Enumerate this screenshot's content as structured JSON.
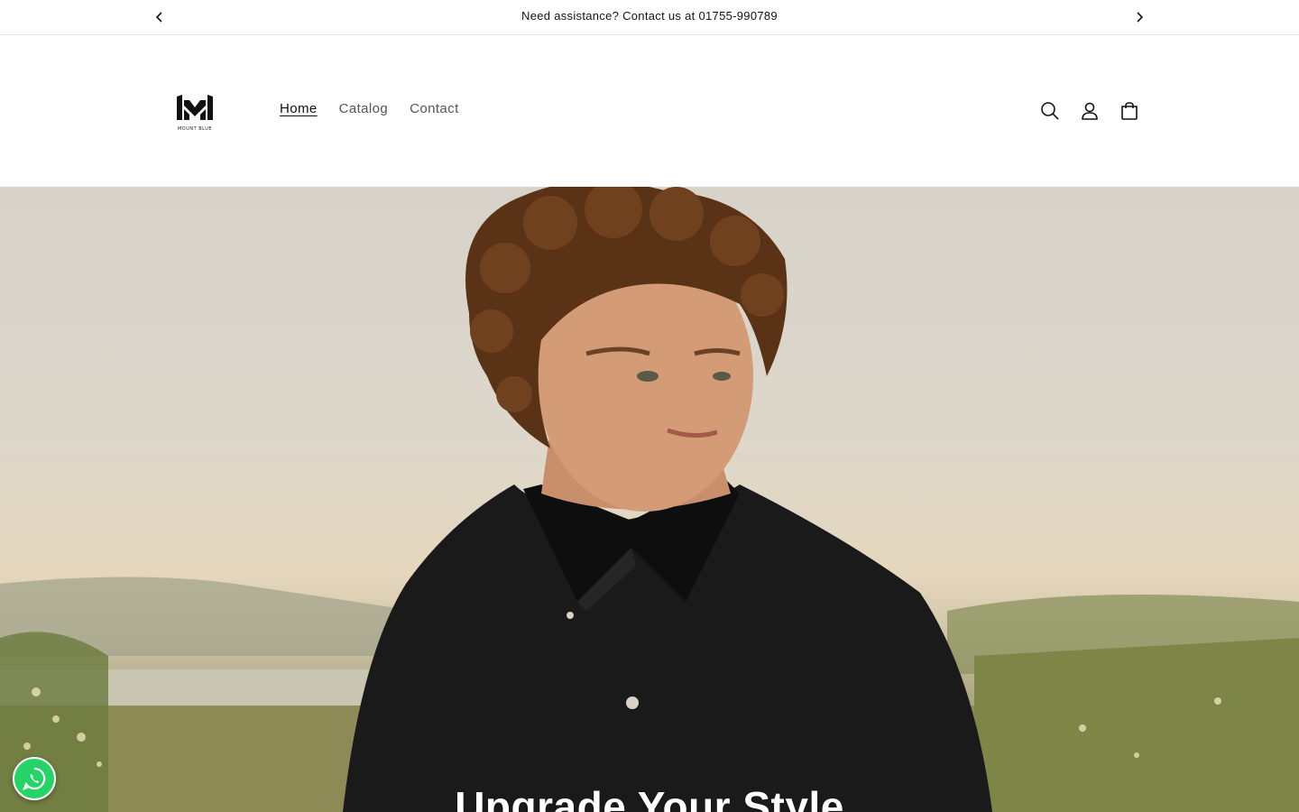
{
  "announcement": {
    "text": "Need assistance? Contact us at 01755-990789",
    "prev_icon": "chevron-left-icon",
    "next_icon": "chevron-right-icon"
  },
  "header": {
    "logo_text": "MOUNT BLUE",
    "nav": [
      {
        "label": "Home",
        "active": true
      },
      {
        "label": "Catalog",
        "active": false
      },
      {
        "label": "Contact",
        "active": false
      }
    ],
    "icons": [
      "search-icon",
      "account-icon",
      "cart-icon"
    ]
  },
  "hero": {
    "title": "Upgrade Your Style",
    "image_alt": "Man with curly hair wearing black shirt in a field"
  },
  "floating": {
    "whatsapp_icon": "whatsapp-icon"
  },
  "colors": {
    "text": "#121212",
    "border": "#e6e6e6",
    "whatsapp": "#25d366"
  }
}
